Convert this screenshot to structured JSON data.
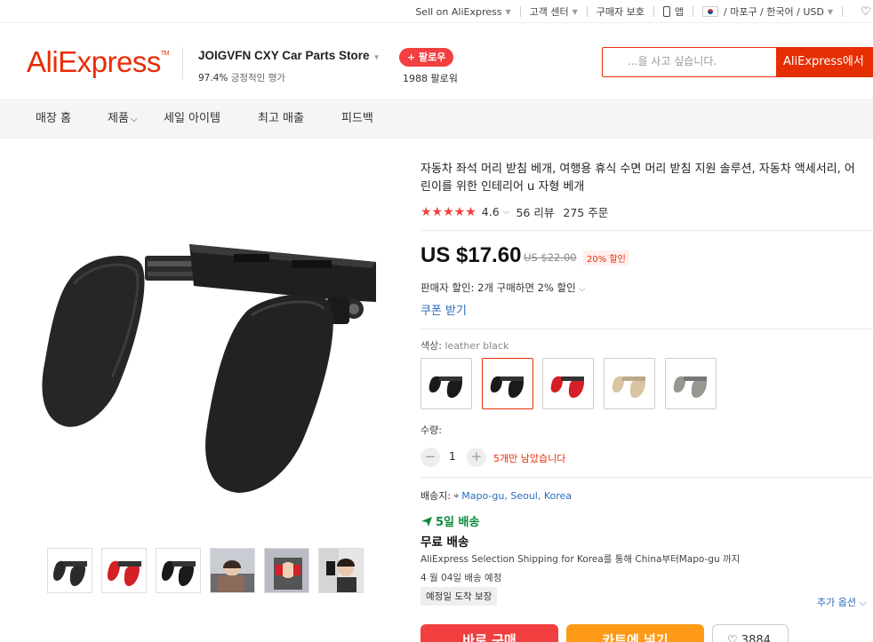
{
  "topbar": {
    "sell": "Sell on AliExpress",
    "support": "고객 센터",
    "buyer_protection": "구매자 보호",
    "app": "앱",
    "region": "/ 마포구 / 한국어 /",
    "currency": "USD"
  },
  "header": {
    "logo": "AliExpress",
    "store_name": "JOIGVFN CXY Car Parts Store",
    "positive_pct": "97.4%",
    "positive_label": "긍정적인 평가",
    "follow": "+ 팔로우",
    "followers": "1988 팔로워",
    "search_placeholder": "...을 사고 싶습니다.",
    "search_button": "AliExpress에서"
  },
  "storenav": {
    "items": [
      "매장 홈",
      "제품",
      "세일 아이템",
      "최고 매출",
      "피드백"
    ]
  },
  "product": {
    "title_line1": "자동차 좌석 머리 받침 베개, 여행용 휴식 수면 머리 받침 지원 솔루션, 자동차 액세서리, 어",
    "title_line2": "린이를 위한 인테리어 u 자형 베개",
    "rating": "4.6",
    "stars": "★★★★★",
    "reviews": "56 리뷰",
    "orders": "275 주문",
    "price": "US $17.60",
    "old_price": "US $22.00",
    "discount": "20% 할인",
    "seller_discount": "판매자 할인: 2개 구매하면 2% 할인",
    "coupon": "쿠폰 받기",
    "color_label": "색상:",
    "color_value": "leather black",
    "swatches": [
      {
        "color": "#1a1a1a"
      },
      {
        "color": "#1a1a1a"
      },
      {
        "color": "#d91f26"
      },
      {
        "color": "#dcc7a6"
      },
      {
        "color": "#9a9a94"
      }
    ],
    "qty_label": "수량:",
    "qty": "1",
    "stock": "5개만 남았습니다",
    "ship_to_label": "배송지:",
    "ship_to": "Mapo-gu, Seoul, Korea",
    "delivery": "5일 배송",
    "free_shipping": "무료 배송",
    "ship_desc": "AliExpress Selection Shipping for Korea를 통해 China부터Mapo-gu 까지",
    "ship_date": "4 월 04일 배송 예정",
    "guarantee": "예정일 도착 보장",
    "more_options": "추가 옵션",
    "buy_now": "바로 구매",
    "add_to_cart": "카트에 넣기",
    "wishlist_count": "3884"
  }
}
